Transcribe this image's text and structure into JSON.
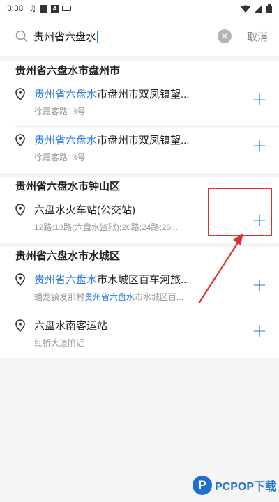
{
  "status_bar": {
    "time": "3:38"
  },
  "search": {
    "query": "贵州省六盘水",
    "cancel_label": "取消"
  },
  "sections": [
    {
      "title": "贵州省六盘水市盘州市",
      "items": [
        {
          "title_hl": "贵州省六盘水",
          "title_rest": "市盘州市双凤镇望...",
          "sub_pre": "",
          "sub_hl": "",
          "sub_post": "徐霞客路13号"
        },
        {
          "title_hl": "贵州省六盘水",
          "title_rest": "市盘州市双凤镇望...",
          "sub_pre": "",
          "sub_hl": "",
          "sub_post": "徐霞客路13号"
        }
      ]
    },
    {
      "title": "贵州省六盘水市钟山区",
      "items": [
        {
          "title_hl": "",
          "title_rest": "六盘水火车站(公交站)",
          "sub_pre": "",
          "sub_hl": "",
          "sub_post": "12路;13路(六盘水监狱);20路;24路;26..."
        }
      ]
    },
    {
      "title": "贵州省六盘水市水城区",
      "items": [
        {
          "title_hl": "贵州省六盘水",
          "title_rest": "市水城区百车河旅...",
          "sub_pre": "蟠龙镇发那村",
          "sub_hl": "贵州省六盘水",
          "sub_post": "市水城区百..."
        },
        {
          "title_hl": "",
          "title_rest": "六盘水南客运站",
          "sub_pre": "",
          "sub_hl": "",
          "sub_post": "红桥大道附近"
        }
      ]
    }
  ],
  "add_label": "+",
  "watermark": {
    "logo": "P",
    "text": "PCPOP下载"
  },
  "colors": {
    "accent": "#2a7be4",
    "annotation": "#e03030"
  }
}
